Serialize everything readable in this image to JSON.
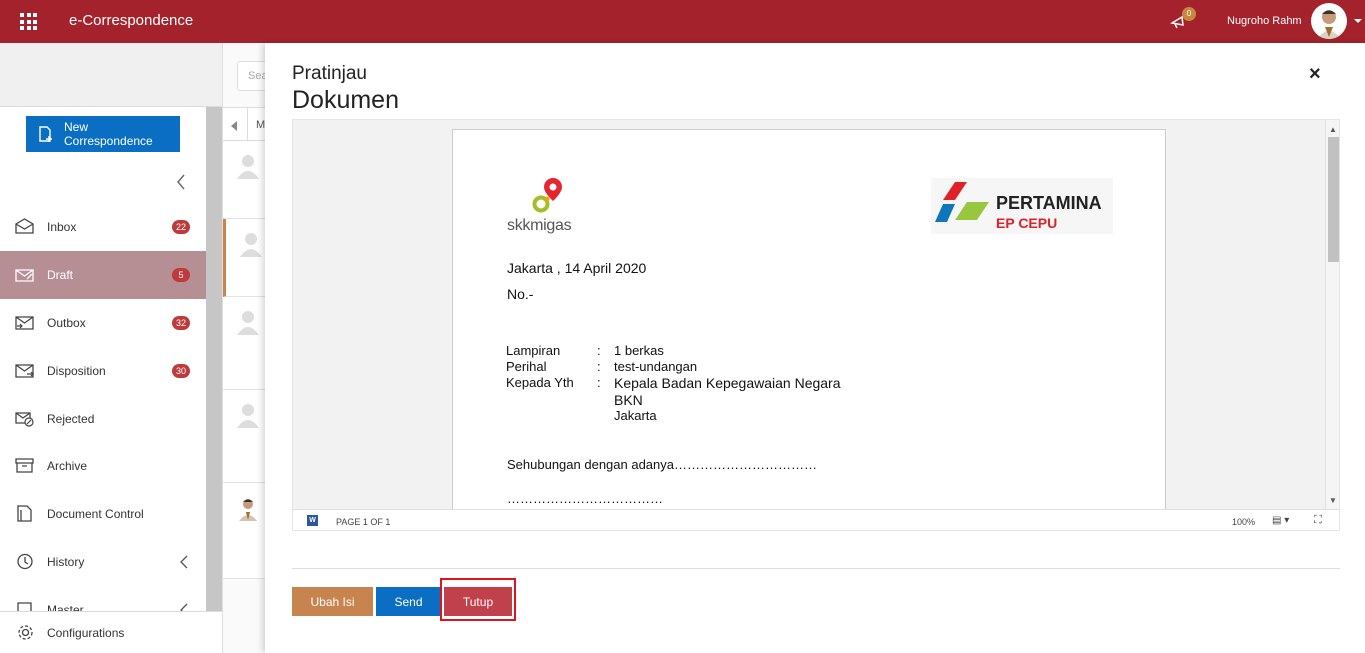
{
  "app": {
    "title": "e-Correspondence",
    "notification_count": "0",
    "user_name": "Nugroho Rahm"
  },
  "sidebar": {
    "new_button": "New Correspondence",
    "items": [
      {
        "label": "Inbox",
        "badge": "22"
      },
      {
        "label": "Draft",
        "badge": "5"
      },
      {
        "label": "Outbox",
        "badge": "32"
      },
      {
        "label": "Disposition",
        "badge": "30"
      },
      {
        "label": "Rejected"
      },
      {
        "label": "Archive"
      },
      {
        "label": "Document Control"
      },
      {
        "label": "History"
      },
      {
        "label": "Master"
      }
    ],
    "config_label": "Configurations"
  },
  "list": {
    "search_placeholder": "Search",
    "header_label": "M"
  },
  "modal": {
    "title_line1": "Pratinjau",
    "title_line2": "Dokumen",
    "close_label": "×",
    "document": {
      "logo_left": "skkmigas",
      "logo_right_line1": "PERTAMINA",
      "logo_right_line2": "EP CEPU",
      "date": "Jakarta , 14 April 2020",
      "number": "No.-",
      "fields": [
        {
          "label": "Lampiran",
          "sep": ":",
          "value": "1 berkas"
        },
        {
          "label": "Perihal",
          "sep": ":",
          "value": "test-undangan"
        },
        {
          "label": "Kepada Yth",
          "sep": ":",
          "value": "Kepala Badan Kepegawaian Negara"
        }
      ],
      "recipient_line2": "BKN",
      "recipient_line3": "Jakarta",
      "body_line1": "Sehubungan dengan adanya……………………………",
      "body_line2": "………………………………"
    },
    "viewer": {
      "page_label": "PAGE 1 OF 1",
      "zoom": "100%",
      "word_icon": "W"
    },
    "buttons": {
      "edit": "Ubah Isi",
      "send": "Send",
      "close": "Tutup"
    }
  },
  "colors": {
    "topbar": "#a4222b",
    "primary": "#0a6fc2",
    "edit": "#c8844f",
    "close": "#c0404b",
    "badge": "#c0393b"
  }
}
